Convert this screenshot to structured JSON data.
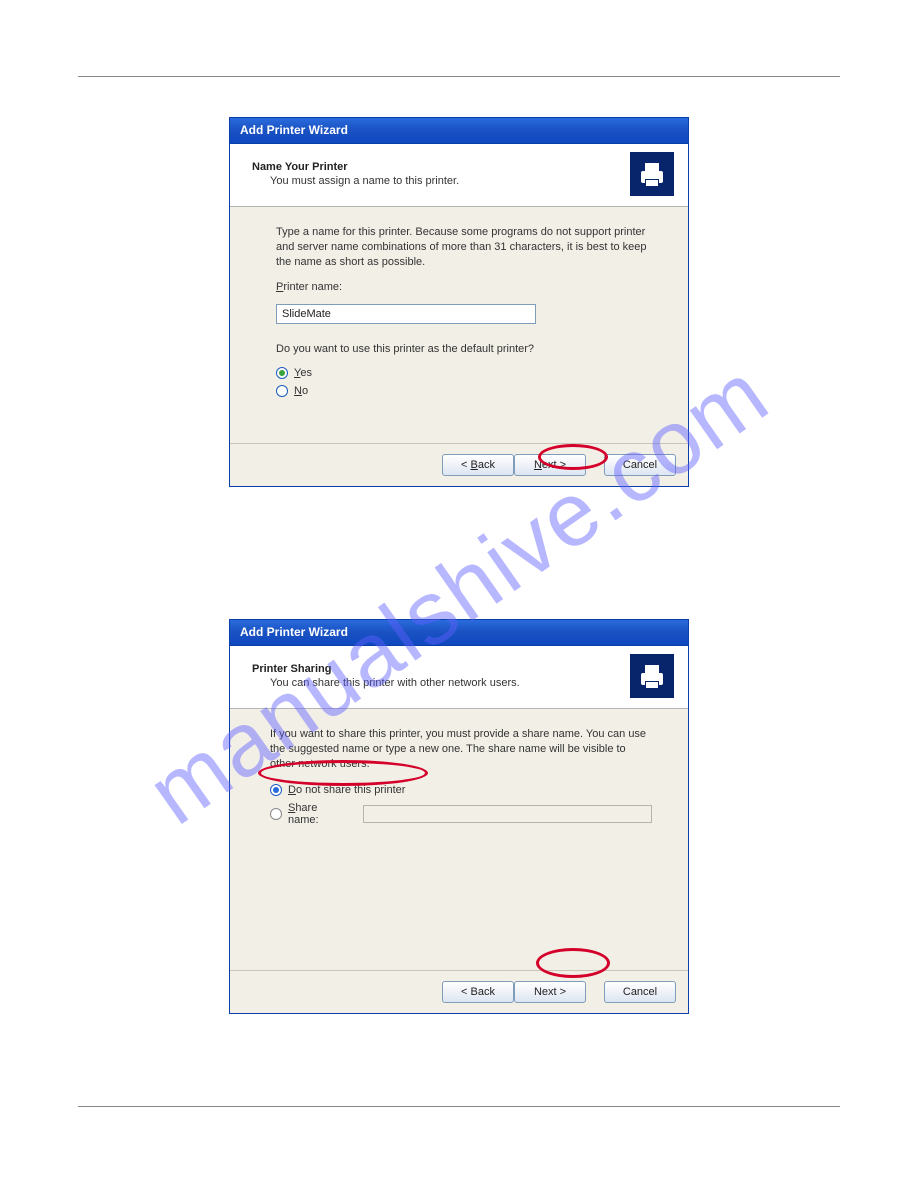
{
  "watermark": "manualshive.com",
  "dialog1": {
    "title": "Add Printer Wizard",
    "heading": "Name Your Printer",
    "subheading": "You must assign a name to this printer.",
    "bodytext": "Type a name for this printer. Because some programs do not support printer and server name combinations of more than 31 characters, it is best to keep the name as short as possible.",
    "printerNameLabelPre": "P",
    "printerNameLabelPost": "rinter name:",
    "printerNameValue": "SlideMate",
    "defaultQuestion": "Do you want to use this printer as the default printer?",
    "yesPre": "Y",
    "yesPost": "es",
    "noPre": "N",
    "noPost": "o",
    "backPre": "< ",
    "backU": "B",
    "backPost": "ack",
    "nextU": "N",
    "nextPost": "ext >",
    "cancel": "Cancel"
  },
  "dialog2": {
    "title": "Add Printer Wizard",
    "heading": "Printer Sharing",
    "subheading": "You can share this printer with other network users.",
    "bodytext": "If you want to share this printer, you must provide a share name. You can use the suggested name or type a new one. The share name will be visible to other network users.",
    "opt1Pre": "D",
    "opt1Post": "o not share this printer",
    "opt2Pre": "S",
    "opt2Post": "hare name:",
    "shareValue": "",
    "backLabel": "< Back",
    "nextLabel": "Next >",
    "cancel": "Cancel"
  }
}
